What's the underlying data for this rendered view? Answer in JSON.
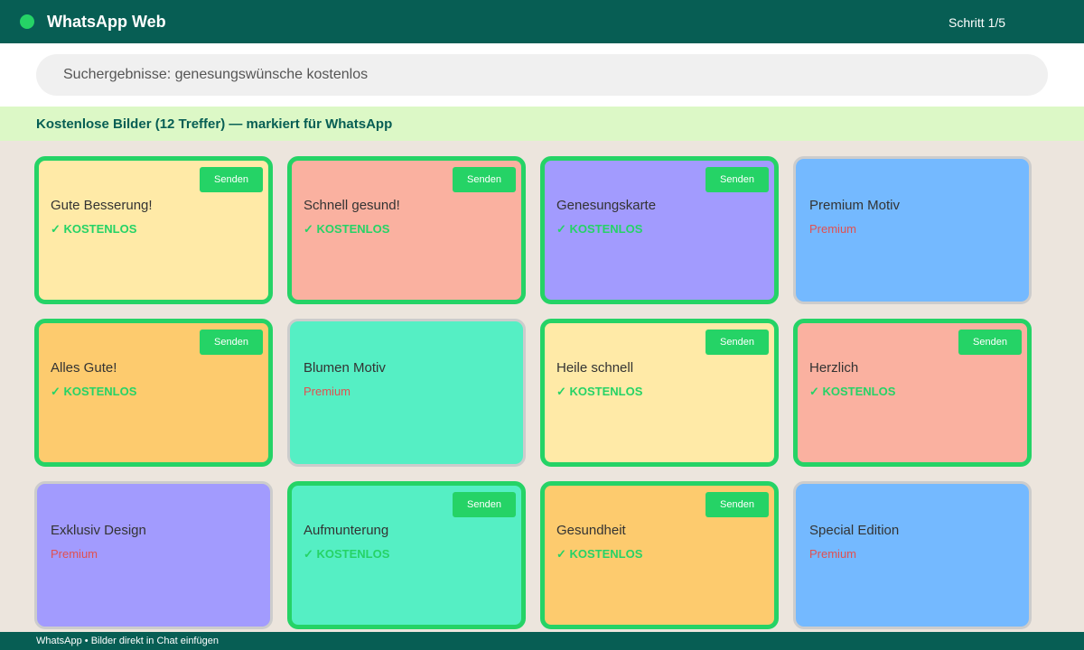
{
  "header": {
    "title": "WhatsApp Web",
    "step": "Schritt 1/5"
  },
  "search": {
    "text": "Suchergebnisse: genesungswünsche kostenlos"
  },
  "results": {
    "heading": "Kostenlose Bilder (12 Treffer) — markiert für WhatsApp"
  },
  "cards": [
    {
      "title": "Gute Besserung!",
      "tag": "✓ KOSTENLOS",
      "button": "Senden",
      "color": "#ffeaa7"
    },
    {
      "title": "Schnell gesund!",
      "tag": "✓ KOSTENLOS",
      "button": "Senden",
      "color": "#fab1a0"
    },
    {
      "title": "Genesungskarte",
      "tag": "✓ KOSTENLOS",
      "button": "Senden",
      "color": "#a29bfe"
    },
    {
      "title": "Premium Motiv",
      "tag": "Premium",
      "color": "#74b9ff"
    },
    {
      "title": "Alles Gute!",
      "tag": "✓ KOSTENLOS",
      "button": "Senden",
      "color": "#fdcb6e"
    },
    {
      "title": "Blumen Motiv",
      "tag": "Premium",
      "color": "#55efc4"
    },
    {
      "title": "Heile schnell",
      "tag": "✓ KOSTENLOS",
      "button": "Senden",
      "color": "#ffeaa7"
    },
    {
      "title": "Herzlich",
      "tag": "✓ KOSTENLOS",
      "button": "Senden",
      "color": "#fab1a0"
    },
    {
      "title": "Exklusiv Design",
      "tag": "Premium",
      "color": "#a29bfe"
    },
    {
      "title": "Aufmunterung",
      "tag": "✓ KOSTENLOS",
      "button": "Senden",
      "color": "#55efc4"
    },
    {
      "title": "Gesundheit",
      "tag": "✓ KOSTENLOS",
      "button": "Senden",
      "color": "#fdcb6e"
    },
    {
      "title": "Special Edition",
      "tag": "Premium",
      "color": "#74b9ff"
    }
  ],
  "footer": {
    "text": "WhatsApp • Bilder direkt in Chat einfügen"
  },
  "colors": {
    "header_bg": "#075e54",
    "accent_green": "#25d366",
    "results_bg": "#dcf8c6",
    "page_bg": "#ece5dd",
    "premium_text": "#e05050"
  }
}
